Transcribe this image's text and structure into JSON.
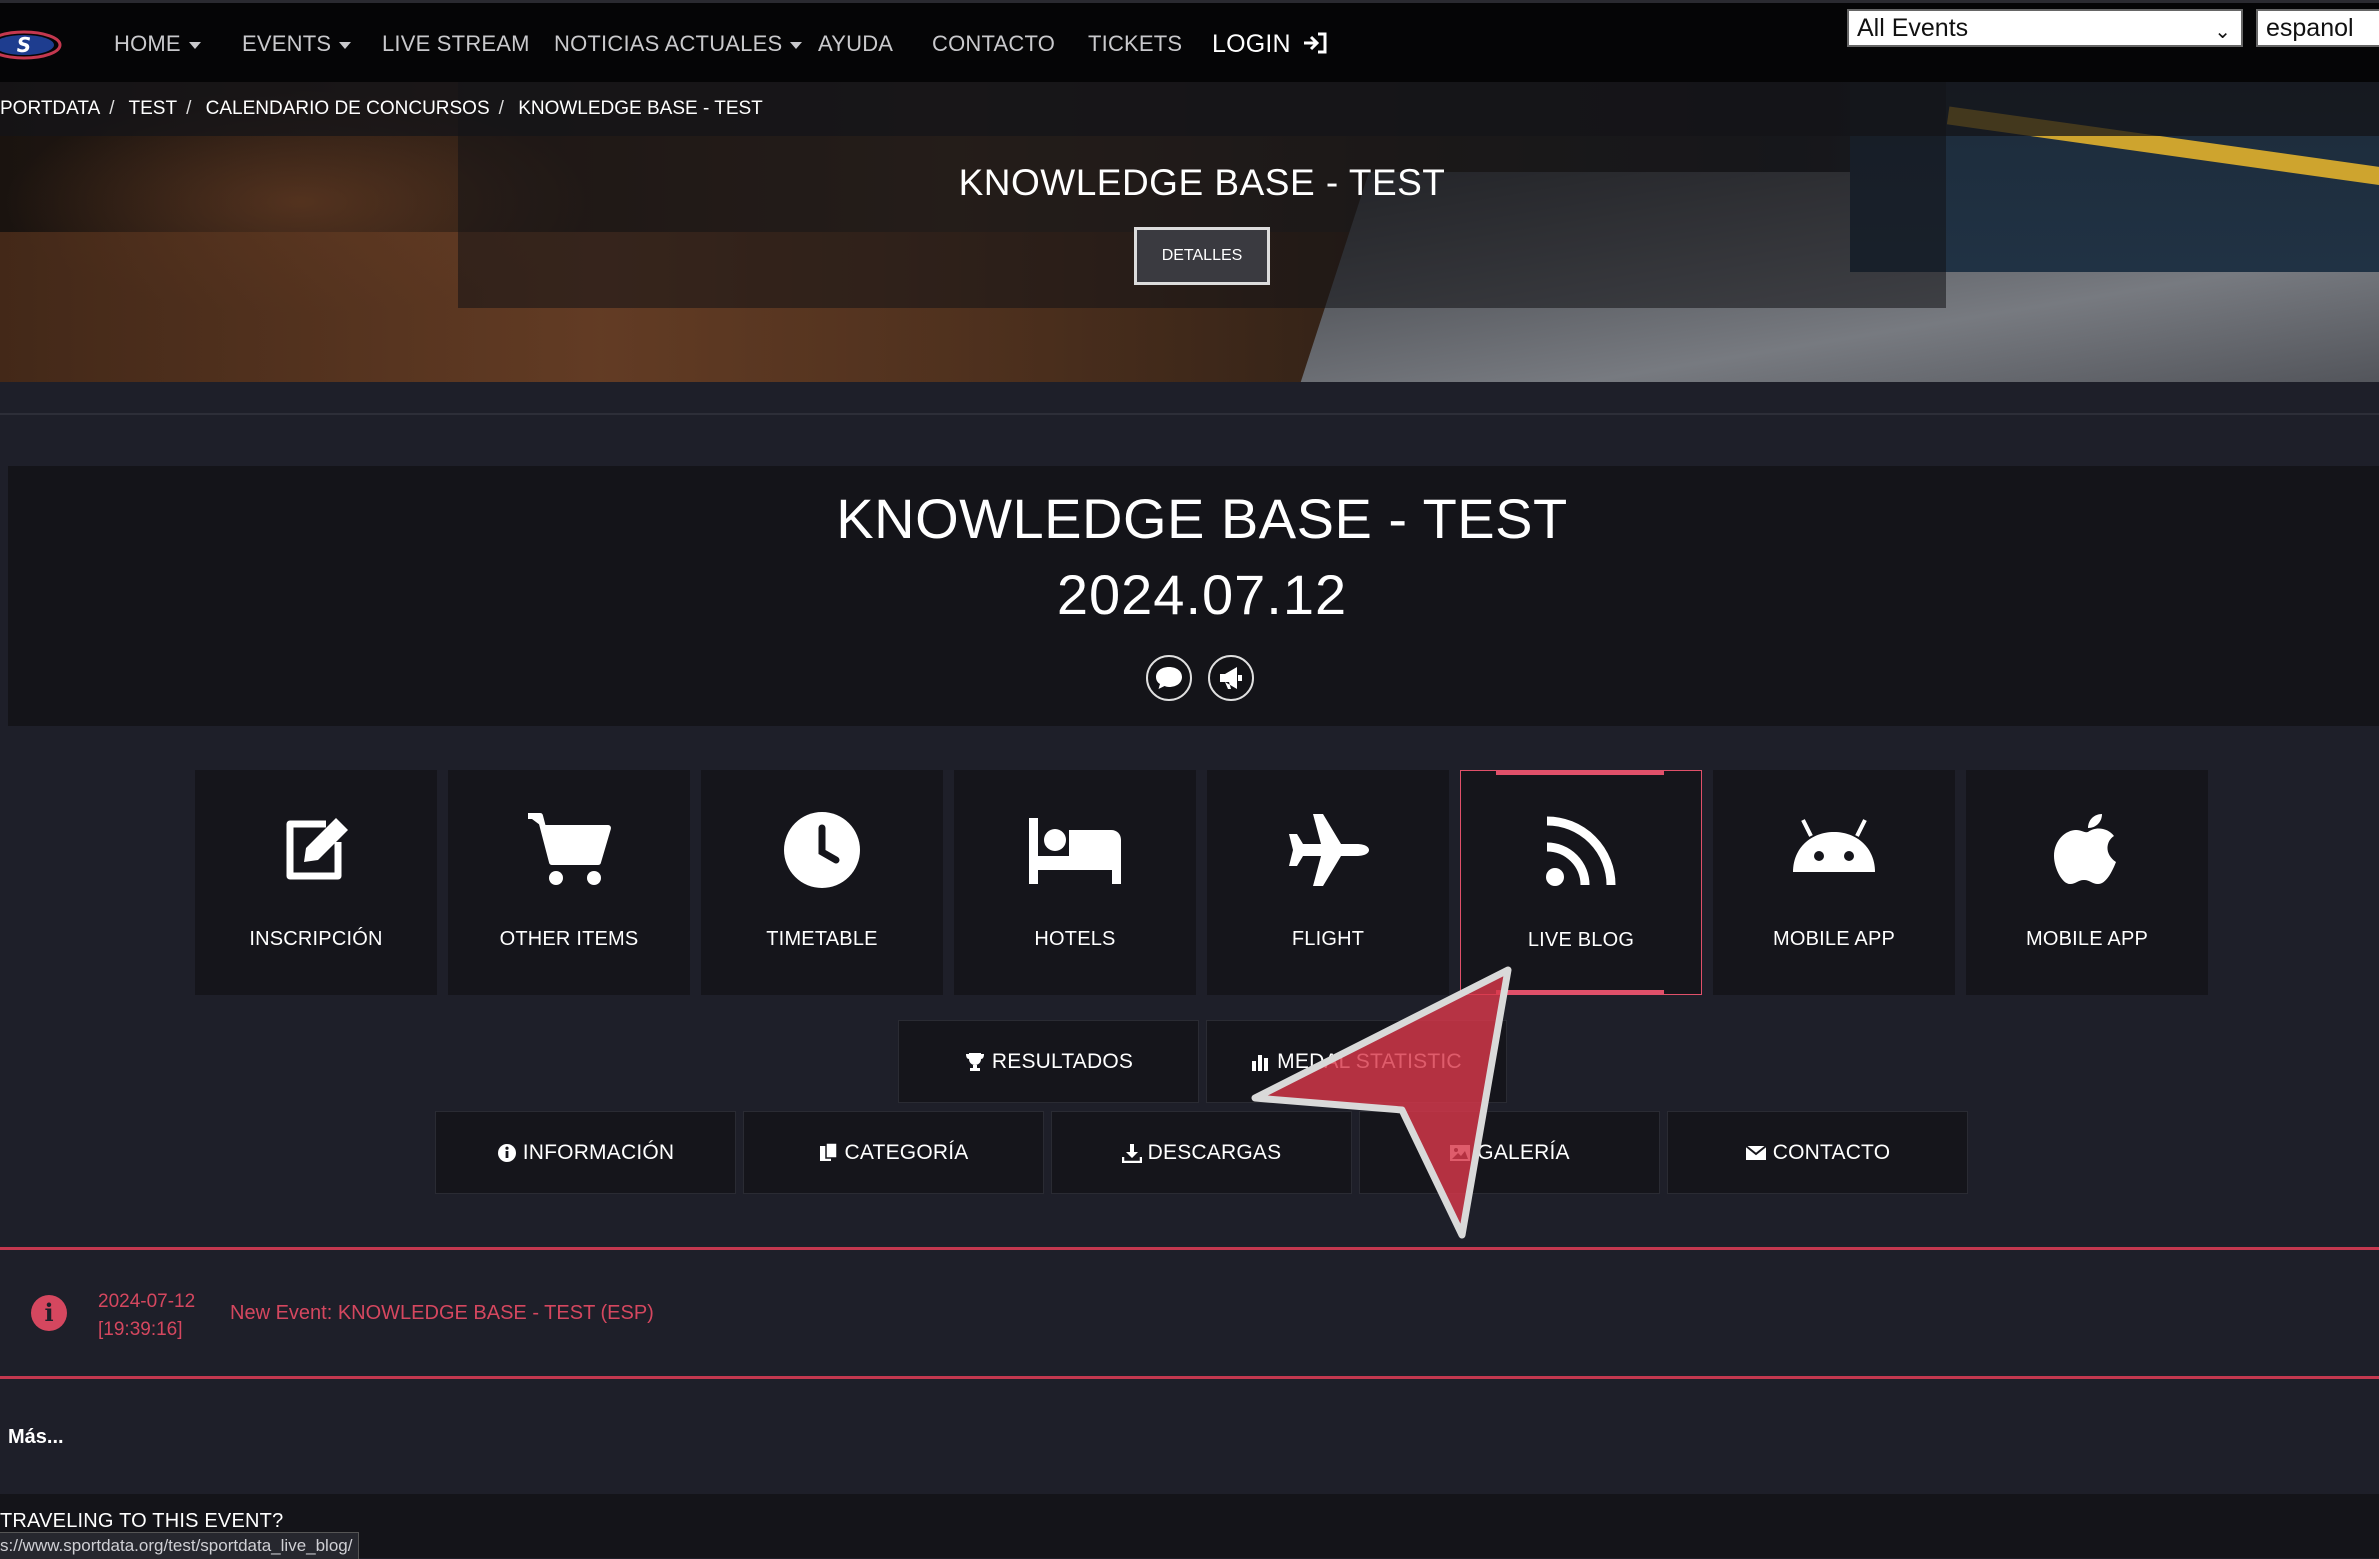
{
  "nav": {
    "items": [
      {
        "label": "HOME",
        "dropdown": true
      },
      {
        "label": "EVENTS",
        "dropdown": true
      },
      {
        "label": "LIVE STREAM",
        "dropdown": false
      },
      {
        "label": "NOTICIAS ACTUALES",
        "dropdown": true
      },
      {
        "label": "AYUDA",
        "dropdown": false
      },
      {
        "label": "CONTACTO",
        "dropdown": false
      },
      {
        "label": "TICKETS",
        "dropdown": false
      }
    ],
    "login_label": "LOGIN",
    "event_select_value": "All Events",
    "language_select_value": "espanol"
  },
  "breadcrumb": [
    "PORTDATA",
    "TEST",
    "CALENDARIO DE CONCURSOS",
    "KNOWLEDGE BASE - TEST"
  ],
  "hero": {
    "title": "KNOWLEDGE BASE - TEST",
    "details_button": "DETALLES"
  },
  "event": {
    "title": "KNOWLEDGE BASE - TEST",
    "date": "2024.07.12",
    "icons": [
      "comment-icon",
      "bullhorn-icon"
    ]
  },
  "tiles": [
    {
      "label": "INSCRIPCIÓN",
      "icon": "edit-icon"
    },
    {
      "label": "OTHER ITEMS",
      "icon": "cart-icon"
    },
    {
      "label": "TIMETABLE",
      "icon": "clock-icon"
    },
    {
      "label": "HOTELS",
      "icon": "bed-icon"
    },
    {
      "label": "FLIGHT",
      "icon": "plane-icon"
    },
    {
      "label": "LIVE BLOG",
      "icon": "rss-icon",
      "active": true
    },
    {
      "label": "MOBILE APP",
      "icon": "android-icon"
    },
    {
      "label": "MOBILE APP",
      "icon": "apple-icon"
    }
  ],
  "buttons_row1": [
    {
      "label": "RESULTADOS",
      "icon": "trophy-icon"
    },
    {
      "label": "MEDAL STATISTIC",
      "icon": "bar-chart-icon"
    }
  ],
  "buttons_row2": [
    {
      "label": "INFORMACIÓN",
      "icon": "info-icon"
    },
    {
      "label": "CATEGORÍA",
      "icon": "copy-icon"
    },
    {
      "label": "DESCARGAS",
      "icon": "download-icon"
    },
    {
      "label": "GALERÍA",
      "icon": "image-icon"
    },
    {
      "label": "CONTACTO",
      "icon": "envelope-icon"
    }
  ],
  "news": {
    "date": "2024-07-12",
    "time": "[19:39:16]",
    "text": "New Event: KNOWLEDGE BASE - TEST (ESP)"
  },
  "more_label": "Más...",
  "traveling_label": "TRAVELING TO THIS EVENT?",
  "status_url": "s://www.sportdata.org/test/sportdata_live_blog/",
  "colors": {
    "accent": "#d5475f",
    "background": "#1e1f29",
    "navbar": "#050506",
    "tile": "#15151b"
  }
}
